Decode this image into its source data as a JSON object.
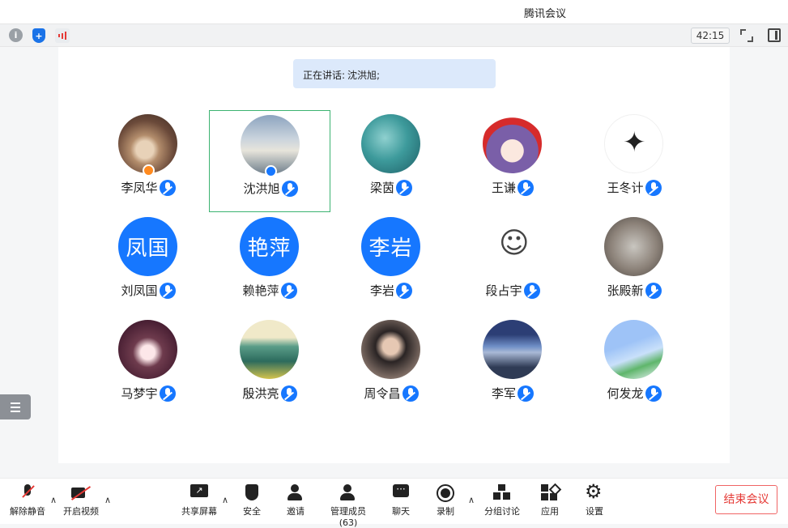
{
  "window": {
    "title": "腾讯会议"
  },
  "topbar": {
    "timer": "42:15"
  },
  "speaking": {
    "label": "正在讲话:",
    "names": "沈洪旭;"
  },
  "participants": [
    {
      "name": "李凤华",
      "avatar_style": "cat",
      "badge": "host"
    },
    {
      "name": "沈洪旭",
      "avatar_style": "sky",
      "badge": "cohost",
      "active": true
    },
    {
      "name": "梁茵",
      "avatar_style": "sea"
    },
    {
      "name": "王谦",
      "avatar_style": "anime"
    },
    {
      "name": "王冬计",
      "avatar_style": "eagle"
    },
    {
      "name": "刘凤国",
      "avatar_text": "凤国"
    },
    {
      "name": "赖艳萍",
      "avatar_text": "艳萍"
    },
    {
      "name": "李岩",
      "avatar_text": "李岩"
    },
    {
      "name": "段占宇",
      "avatar_style": "sketch"
    },
    {
      "name": "张殿新",
      "avatar_style": "hang"
    },
    {
      "name": "马梦宇",
      "avatar_style": "girl"
    },
    {
      "name": "殷洪亮",
      "avatar_style": "mount"
    },
    {
      "name": "周令昌",
      "avatar_style": "photo"
    },
    {
      "name": "李军",
      "avatar_style": "lake"
    },
    {
      "name": "何发龙",
      "avatar_style": "flower"
    }
  ],
  "toolbar": {
    "unmute": "解除静音",
    "start_video": "开启视频",
    "share_screen": "共享屏幕",
    "security": "安全",
    "invite": "邀请",
    "manage_members": "管理成员(63)",
    "chat": "聊天",
    "record": "录制",
    "breakout": "分组讨论",
    "apps": "应用",
    "settings": "设置",
    "end_meeting": "结束会议"
  },
  "colors": {
    "accent": "#1677ff",
    "speaking_bg": "#dce9fb",
    "active_border": "#3cb371",
    "end_red": "#e53935"
  }
}
